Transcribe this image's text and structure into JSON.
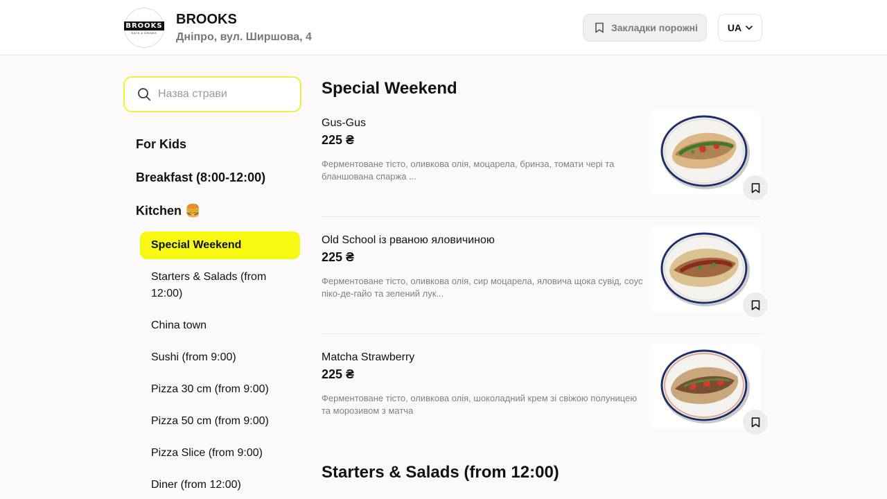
{
  "header": {
    "logo_text": "BROOKS",
    "logo_sub": "EATS & DRINKS",
    "brand_name": "BROOKS",
    "address": "Дніпро, вул. Ширшова, 4",
    "bookmarks_label": "Закладки порожні",
    "language": "UA"
  },
  "search": {
    "placeholder": "Назва страви"
  },
  "sidebar": {
    "categories": [
      {
        "label": "For Kids"
      },
      {
        "label": "Breakfast (8:00-12:00)"
      },
      {
        "label": "Kitchen 🍔"
      }
    ],
    "subcategories": [
      {
        "label": "Special Weekend",
        "active": true
      },
      {
        "label": "Starters & Salads (from 12:00)"
      },
      {
        "label": "China town"
      },
      {
        "label": "Sushi (from 9:00)"
      },
      {
        "label": "Pizza 30 cm (from 9:00)"
      },
      {
        "label": "Pizza 50 cm (from 9:00)"
      },
      {
        "label": "Pizza Slice (from 9:00)"
      },
      {
        "label": "Diner (from 12:00)"
      }
    ]
  },
  "main": {
    "sections": [
      {
        "title": "Special Weekend",
        "items": [
          {
            "name": "Gus-Gus",
            "price": "225 ₴",
            "description": "Ферментоване тісто, оливкова олія, моцарела, бринза, томати чері та бланшована спаржа ...",
            "filling": "green"
          },
          {
            "name": "Old School із рваною яловичиною",
            "price": "225 ₴",
            "description": "Ферментоване тісто, оливкова олія, сир моцарела, яловича щока сувід, соус піко-де-гайо та зелений лук...",
            "filling": "red"
          },
          {
            "name": "Matcha Strawberry",
            "price": "225 ₴",
            "description": "Ферментоване тісто, оливкова олія, шоколадний крем зі свіжою полуницею та морозивом з матча",
            "filling": "strawberry"
          }
        ]
      },
      {
        "title": "Starters & Salads (from 12:00)",
        "items": []
      }
    ]
  },
  "colors": {
    "accent": "#f7f913",
    "search_border": "#eef03a",
    "muted_text": "#808080"
  }
}
